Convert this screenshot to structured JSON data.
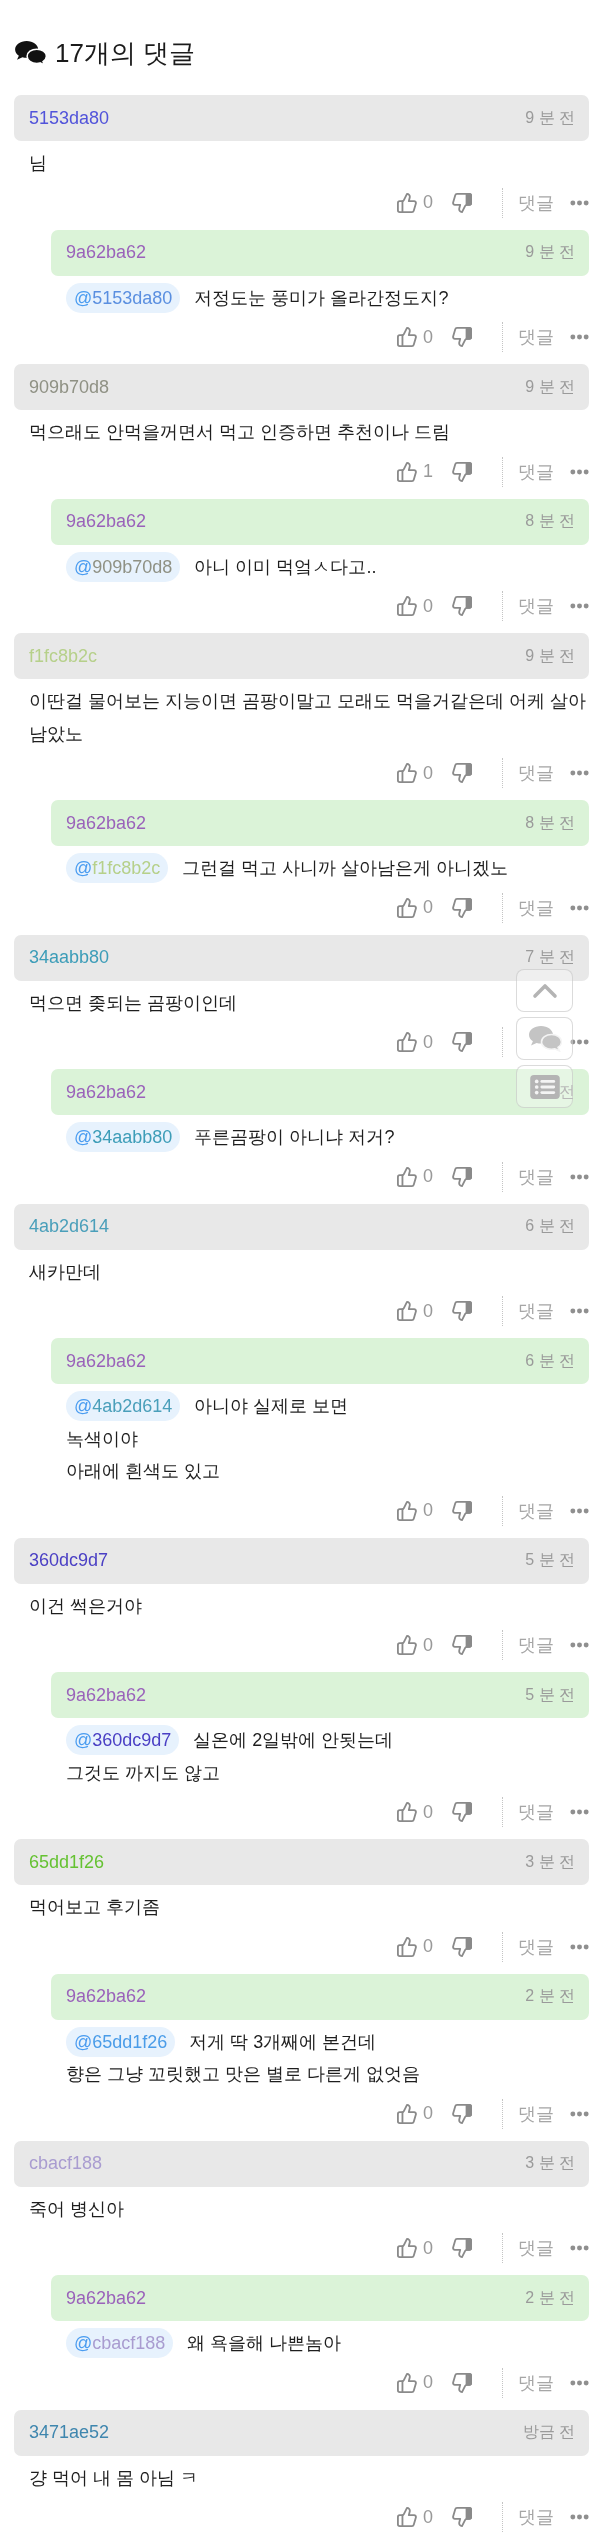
{
  "title": "17개의 댓글",
  "comments": [
    {
      "author": "5153da80",
      "color": "#5153da",
      "time": "9 분 전",
      "text": "님",
      "likes": "0",
      "reply": "댓글",
      "children": [
        {
          "author": "9a62ba62",
          "color": "#9a62ba",
          "time": "9 분 전",
          "mention": {
            "text": "@5153da80",
            "color": "#5a8fe0"
          },
          "text": "저정도눈 풍미가 올라간정도지?",
          "likes": "0",
          "reply": "댓글"
        }
      ]
    },
    {
      "author": "909b70d8",
      "color": "#8f9184",
      "time": "9 분 전",
      "text": "먹으래도 안먹을꺼면서 먹고 인증하면 추천이나 드림",
      "likes": "1",
      "reply": "댓글",
      "children": [
        {
          "author": "9a62ba62",
          "color": "#9a62ba",
          "time": "8 분 전",
          "mention": {
            "text": "@909b70d8",
            "color": "#8f9184"
          },
          "text": "아니 이미 먹엌ㅅ다고..",
          "likes": "0",
          "reply": "댓글"
        }
      ]
    },
    {
      "author": "f1fc8b2c",
      "color": "#b6d08a",
      "time": "9 분 전",
      "text": "이딴걸 물어보는 지능이면 곰팡이말고 모래도 먹을거같은데 어케 살아남았노",
      "likes": "0",
      "reply": "댓글",
      "children": [
        {
          "author": "9a62ba62",
          "color": "#9a62ba",
          "time": "8 분 전",
          "mention": {
            "text": "@f1fc8b2c",
            "color": "#b6d08a"
          },
          "text": "그런걸 먹고 사니까 살아남은게 아니겠노",
          "likes": "0",
          "reply": "댓글"
        }
      ]
    },
    {
      "author": "34aabb80",
      "color": "#3d9db8",
      "time": "7 분 전",
      "text": "먹으면 좆되는 곰팡이인데",
      "likes": "0",
      "children": [
        {
          "author": "9a62ba62",
          "color": "#9a62ba",
          "time": "전",
          "mention": {
            "text": "@34aabb80",
            "color": "#3d9db8"
          },
          "text": "푸른곰팡이 아니냐 저거?",
          "likes": "0",
          "reply": "댓글"
        }
      ]
    },
    {
      "author": "4ab2d614",
      "color": "#4a9fba",
      "time": "6 분 전",
      "text": "새카만데",
      "likes": "0",
      "reply": "댓글",
      "children": [
        {
          "author": "9a62ba62",
          "color": "#9a62ba",
          "time": "6 분 전",
          "mention": {
            "text": "@4ab2d614",
            "color": "#4a9fba"
          },
          "text": "아니야 실제로 보면\n녹색이야\n아래에 흰색도 있고",
          "likes": "0",
          "reply": "댓글"
        }
      ]
    },
    {
      "author": "360dc9d7",
      "color": "#4a3fc4",
      "time": "5 분 전",
      "text": "이건 썩은거야",
      "likes": "0",
      "reply": "댓글",
      "children": [
        {
          "author": "9a62ba62",
          "color": "#9a62ba",
          "time": "5 분 전",
          "mention": {
            "text": "@360dc9d7",
            "color": "#4a3fc4"
          },
          "text": "실온에 2일밖에 안됫는데\n그것도 까지도 않고",
          "likes": "0",
          "reply": "댓글"
        }
      ]
    },
    {
      "author": "65dd1f26",
      "color": "#65c232",
      "time": "3 분 전",
      "text": "먹어보고 후기좀",
      "likes": "0",
      "reply": "댓글",
      "children": [
        {
          "author": "9a62ba62",
          "color": "#9a62ba",
          "time": "2 분 전",
          "mention": {
            "text": "@65dd1f26",
            "color": "#4a9ce8"
          },
          "text": "저게 딱 3개째에 본건데\n향은 그냥 꼬릿했고 맛은 별로 다른게 없엇음",
          "likes": "0",
          "reply": "댓글"
        }
      ]
    },
    {
      "author": "cbacf188",
      "color": "#a99cd0",
      "time": "3 분 전",
      "text": "죽어 병신아",
      "likes": "0",
      "reply": "댓글",
      "children": [
        {
          "author": "9a62ba62",
          "color": "#9a62ba",
          "time": "2 분 전",
          "mention": {
            "text": "@cbacf188",
            "color": "#a99cd0"
          },
          "text": "왜 욕을해 나쁜놈아",
          "likes": "0",
          "reply": "댓글"
        }
      ]
    },
    {
      "author": "3471ae52",
      "color": "#3f86ae",
      "time": "방금 전",
      "text": "걍 먹어 내 몸 아님 ㅋ",
      "likes": "0",
      "reply": "댓글"
    }
  ]
}
